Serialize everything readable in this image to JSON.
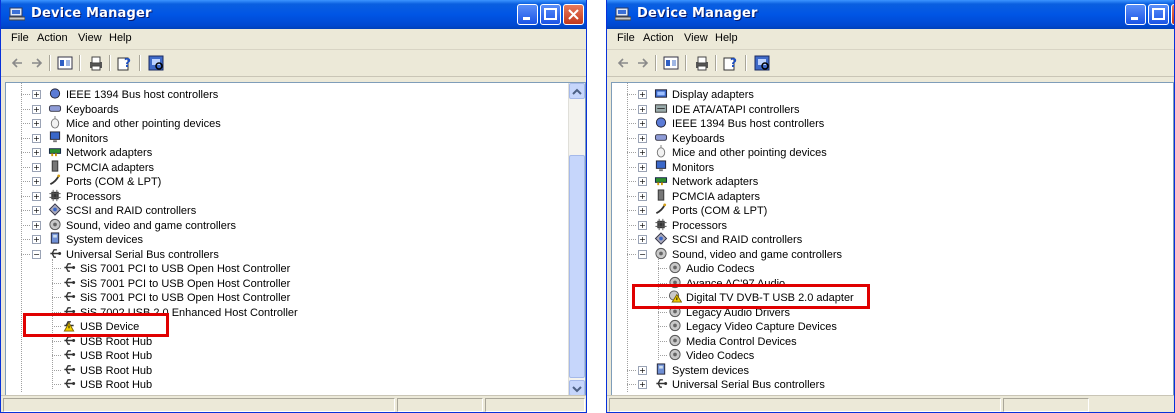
{
  "colors": {
    "title_blue": "#0055e5",
    "highlight_red": "#e00000"
  },
  "window_left": {
    "title": "Device Manager",
    "menus": [
      "File",
      "Action",
      "View",
      "Help"
    ],
    "tree": [
      {
        "label": "IEEE 1394 Bus host controllers",
        "icon": "ieee1394-icon",
        "level": 0
      },
      {
        "label": "Keyboards",
        "icon": "keyboard-icon",
        "level": 0
      },
      {
        "label": "Mice and other pointing devices",
        "icon": "mouse-icon",
        "level": 0
      },
      {
        "label": "Monitors",
        "icon": "monitor-icon",
        "level": 0
      },
      {
        "label": "Network adapters",
        "icon": "network-adapter-icon",
        "level": 0
      },
      {
        "label": "PCMCIA adapters",
        "icon": "pcmcia-icon",
        "level": 0
      },
      {
        "label": "Ports (COM & LPT)",
        "icon": "port-icon",
        "level": 0
      },
      {
        "label": "Processors",
        "icon": "processor-icon",
        "level": 0
      },
      {
        "label": "SCSI and RAID controllers",
        "icon": "scsi-icon",
        "level": 0
      },
      {
        "label": "Sound, video and game controllers",
        "icon": "sound-icon",
        "level": 0
      },
      {
        "label": "System devices",
        "icon": "system-device-icon",
        "level": 0
      },
      {
        "label": "Universal Serial Bus controllers",
        "icon": "usb-icon",
        "level": 0,
        "expanded": true
      },
      {
        "label": "SiS 7001 PCI to USB Open Host Controller",
        "icon": "usb-icon",
        "level": 1
      },
      {
        "label": "SiS 7001 PCI to USB Open Host Controller",
        "icon": "usb-icon",
        "level": 1
      },
      {
        "label": "SiS 7001 PCI to USB Open Host Controller",
        "icon": "usb-icon",
        "level": 1
      },
      {
        "label": "SiS 7002 USB 2.0 Enhanced Host Controller",
        "icon": "usb-icon",
        "level": 1
      },
      {
        "label": "USB Device",
        "icon": "usb-warning-icon",
        "level": 1,
        "highlighted": true
      },
      {
        "label": "USB Root Hub",
        "icon": "usb-icon",
        "level": 1
      },
      {
        "label": "USB Root Hub",
        "icon": "usb-icon",
        "level": 1
      },
      {
        "label": "USB Root Hub",
        "icon": "usb-icon",
        "level": 1
      },
      {
        "label": "USB Root Hub",
        "icon": "usb-icon",
        "level": 1
      }
    ]
  },
  "window_right": {
    "title": "Device Manager",
    "menus": [
      "File",
      "Action",
      "View",
      "Help"
    ],
    "tree": [
      {
        "label": "Display adapters",
        "icon": "display-adapter-icon",
        "level": 0
      },
      {
        "label": "IDE ATA/ATAPI controllers",
        "icon": "ide-icon",
        "level": 0
      },
      {
        "label": "IEEE 1394 Bus host controllers",
        "icon": "ieee1394-icon",
        "level": 0
      },
      {
        "label": "Keyboards",
        "icon": "keyboard-icon",
        "level": 0
      },
      {
        "label": "Mice and other pointing devices",
        "icon": "mouse-icon",
        "level": 0
      },
      {
        "label": "Monitors",
        "icon": "monitor-icon",
        "level": 0
      },
      {
        "label": "Network adapters",
        "icon": "network-adapter-icon",
        "level": 0
      },
      {
        "label": "PCMCIA adapters",
        "icon": "pcmcia-icon",
        "level": 0
      },
      {
        "label": "Ports (COM & LPT)",
        "icon": "port-icon",
        "level": 0
      },
      {
        "label": "Processors",
        "icon": "processor-icon",
        "level": 0
      },
      {
        "label": "SCSI and RAID controllers",
        "icon": "scsi-icon",
        "level": 0
      },
      {
        "label": "Sound, video and game controllers",
        "icon": "sound-icon",
        "level": 0,
        "expanded": true
      },
      {
        "label": "Audio Codecs",
        "icon": "sound-icon",
        "level": 1
      },
      {
        "label": "Avance AC'97 Audio",
        "icon": "sound-icon",
        "level": 1
      },
      {
        "label": "Digital TV DVB-T USB 2.0 adapter",
        "icon": "warning-device-icon",
        "level": 1,
        "highlighted": true
      },
      {
        "label": "Legacy Audio Drivers",
        "icon": "sound-icon",
        "level": 1
      },
      {
        "label": "Legacy Video Capture Devices",
        "icon": "sound-icon",
        "level": 1
      },
      {
        "label": "Media Control Devices",
        "icon": "sound-icon",
        "level": 1
      },
      {
        "label": "Video Codecs",
        "icon": "sound-icon",
        "level": 1
      },
      {
        "label": "System devices",
        "icon": "system-device-icon",
        "level": 0
      },
      {
        "label": "Universal Serial Bus controllers",
        "icon": "usb-icon",
        "level": 0
      }
    ]
  }
}
